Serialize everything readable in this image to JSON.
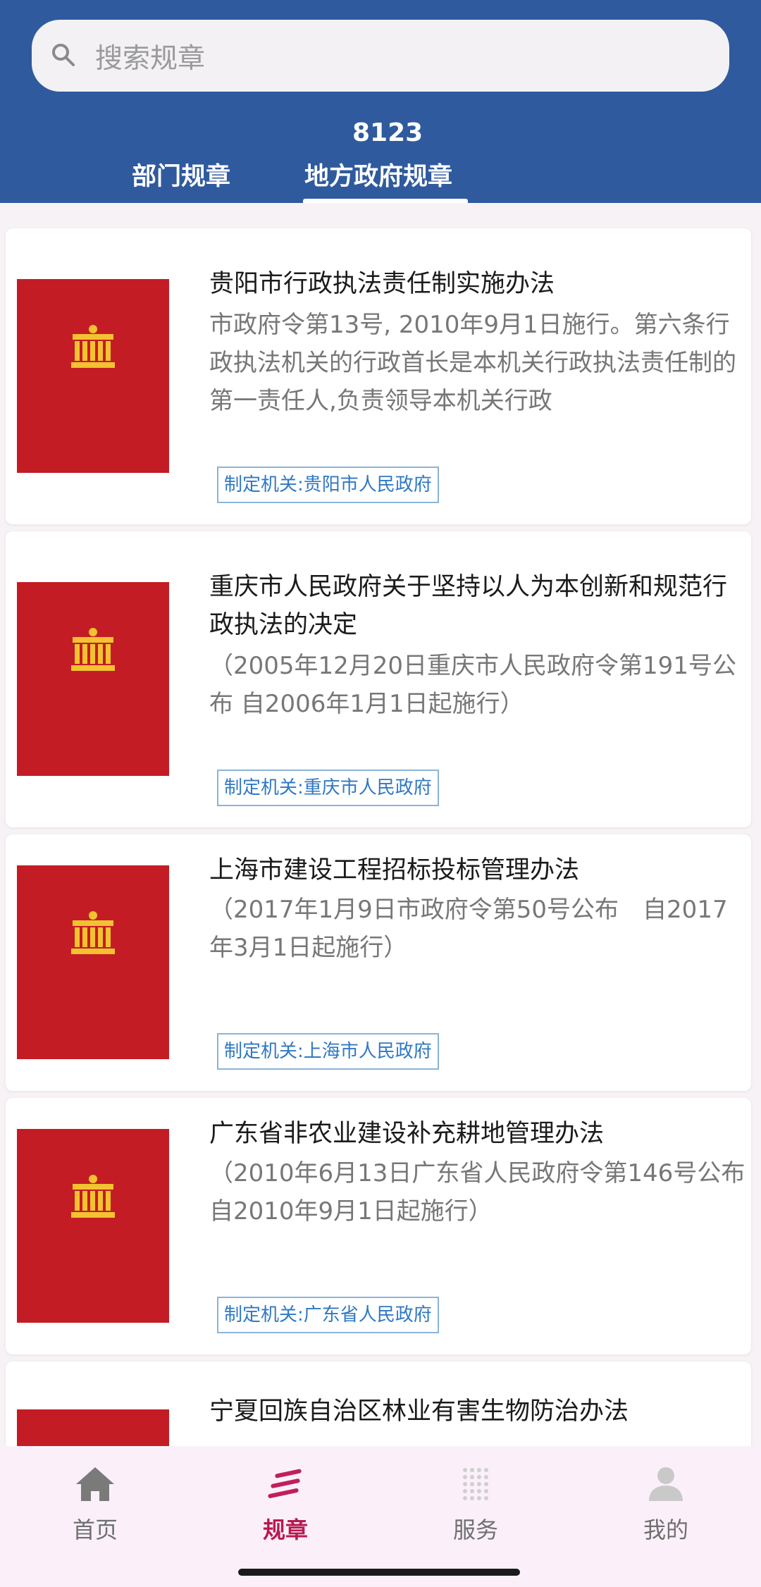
{
  "search": {
    "placeholder": "搜索规章"
  },
  "header": {
    "count": "8123",
    "tabs": [
      "部门规章",
      "地方政府规章"
    ],
    "active_tab": "地方政府规章"
  },
  "cards": [
    {
      "title": "贵阳市行政执法责任制实施办法",
      "desc": "市政府令第13号, 2010年9月1日施行。第六条行政执法机关的行政首长是本机关行政执法责任制的第一责任人,负责领导本机关行政",
      "issuer": "制定机关:贵阳市人民政府"
    },
    {
      "title": "重庆市人民政府关于坚持以人为本创新和规范行政执法的决定",
      "desc": "（2005年12月20日重庆市人民政府令第191号公布 自2006年1月1日起施行）",
      "issuer": "制定机关:重庆市人民政府"
    },
    {
      "title": "上海市建设工程招标投标管理办法",
      "desc": "（2017年1月9日市政府令第50号公布　自2017年3月1日起施行）",
      "issuer": "制定机关:上海市人民政府"
    },
    {
      "title": "广东省非农业建设补充耕地管理办法",
      "desc": "（2010年6月13日广东省人民政府令第146号公布　自2010年9月1日起施行）",
      "issuer": "制定机关:广东省人民政府"
    },
    {
      "title": "宁夏回族自治区林业有害生物防治办法"
    }
  ],
  "bottom_nav": [
    {
      "label": "首页",
      "icon": "home-icon"
    },
    {
      "label": "规章",
      "icon": "rules-icon",
      "active": true
    },
    {
      "label": "服务",
      "icon": "services-icon"
    },
    {
      "label": "我的",
      "icon": "profile-icon"
    }
  ],
  "colors": {
    "header_bg": "#2f5a9e",
    "cover_red": "#c41c24",
    "emblem_gold": "#f2c230",
    "active_nav": "#b8194e",
    "issuer_blue": "#2f78c4"
  }
}
